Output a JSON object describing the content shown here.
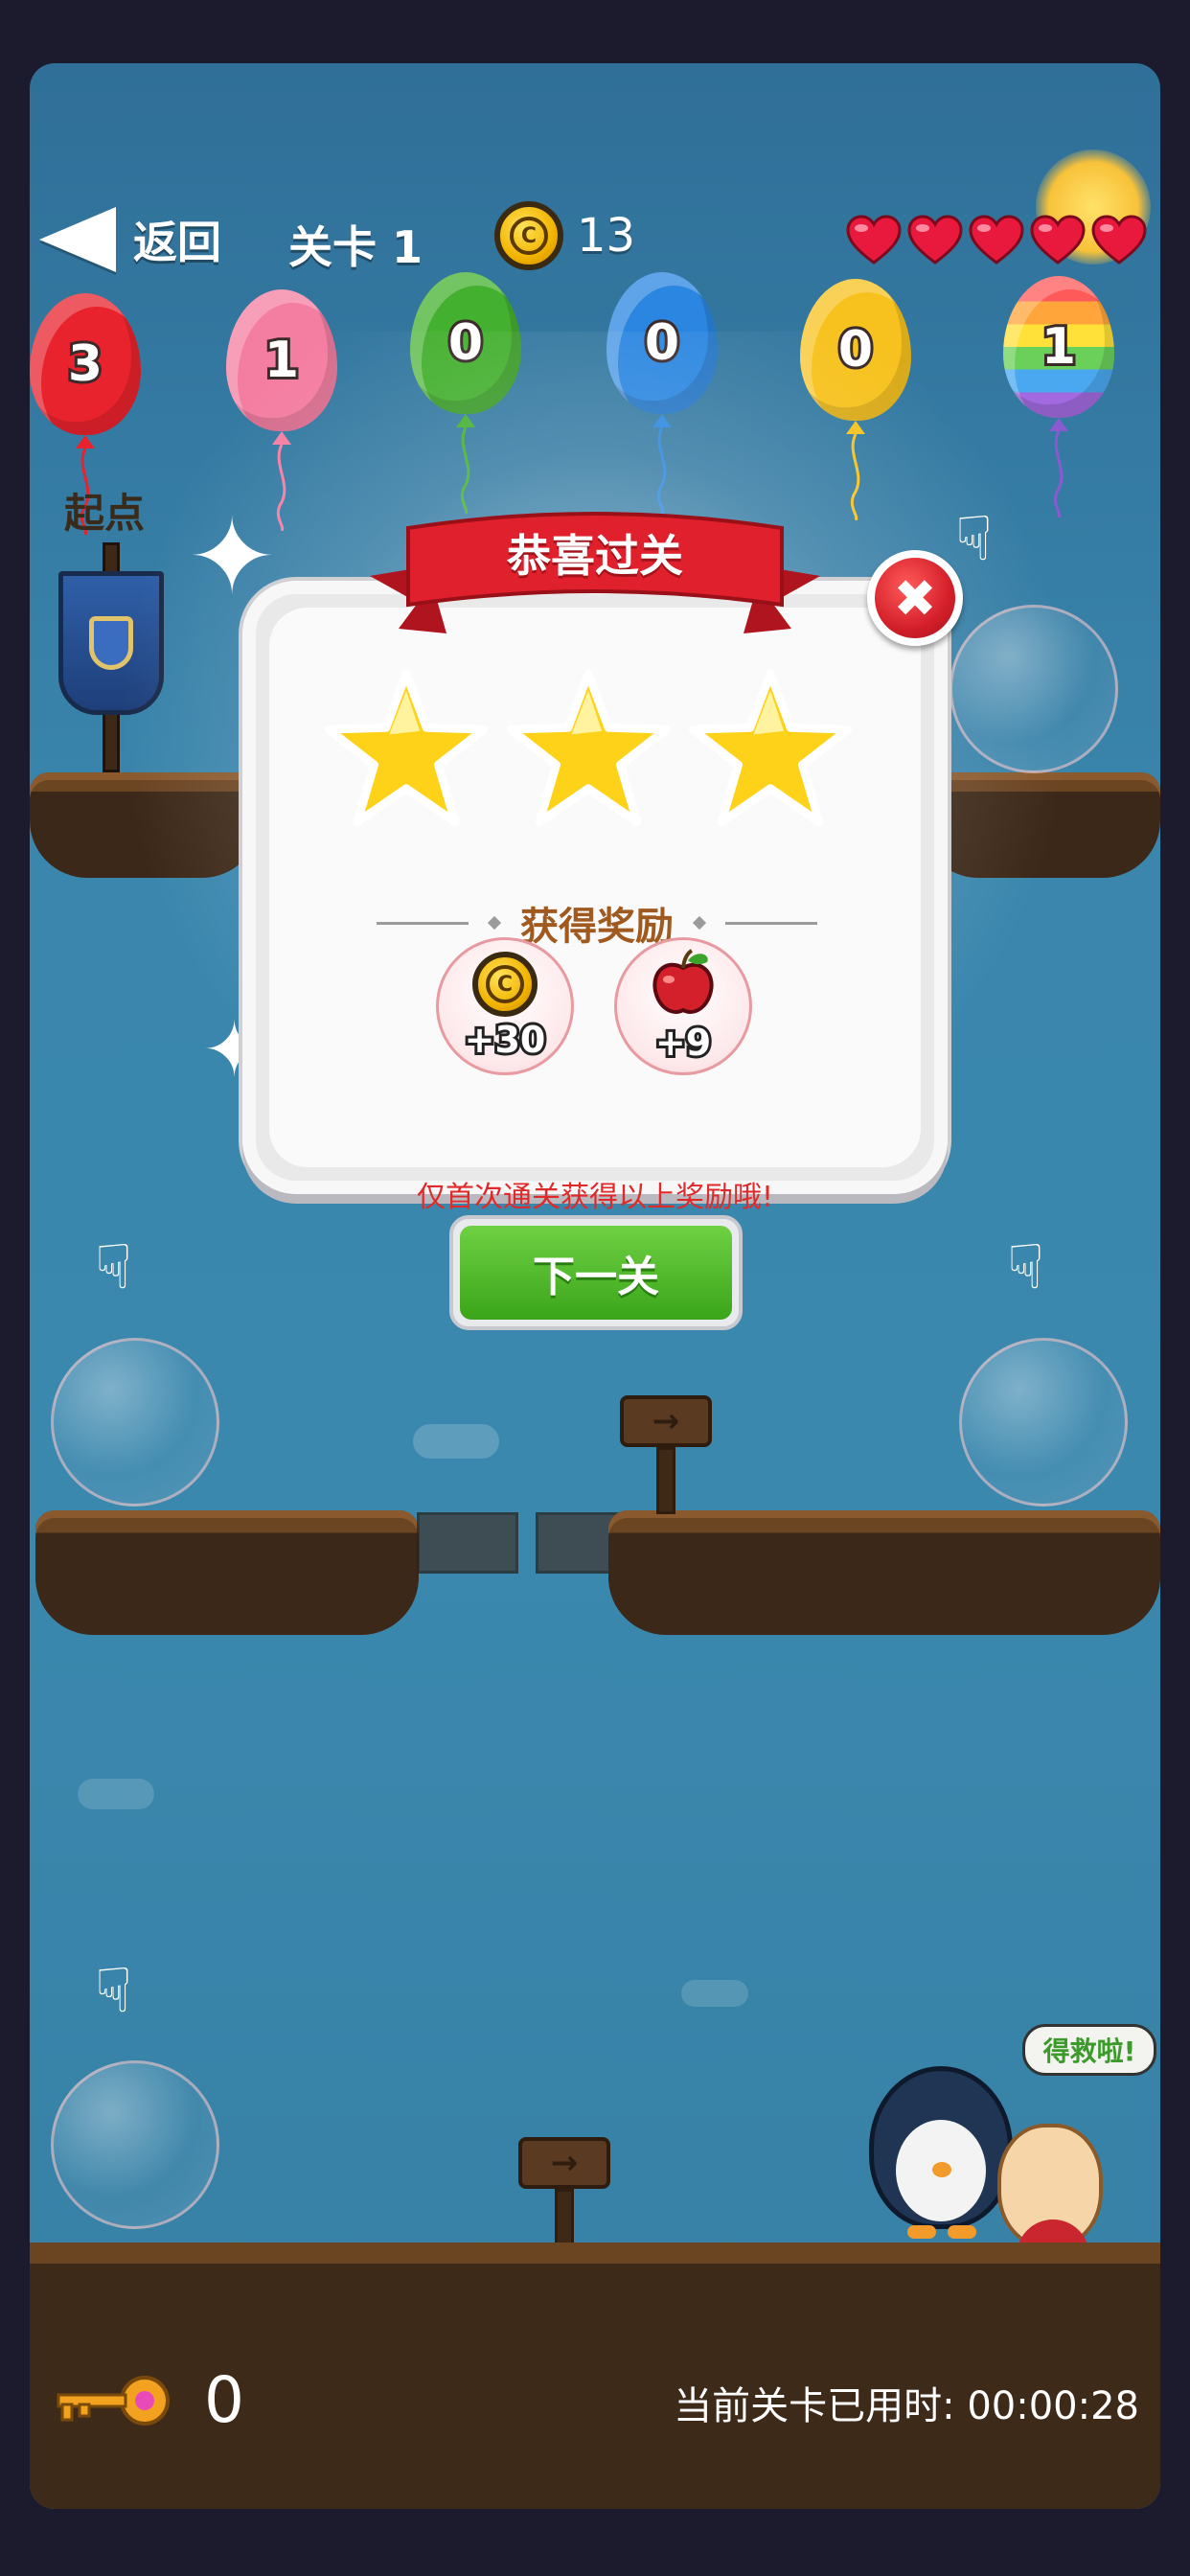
{
  "topbar": {
    "back_label": "返回",
    "level_label": "关卡 1",
    "coins": "13",
    "hearts": 5
  },
  "balloons": [
    {
      "num": "3",
      "color": "#e8232d"
    },
    {
      "num": "1",
      "color": "#f47ea2"
    },
    {
      "num": "0",
      "color": "#44b02f"
    },
    {
      "num": "0",
      "color": "#2a86e0"
    },
    {
      "num": "0",
      "color": "#f7c21e"
    },
    {
      "num": "1",
      "color": "rainbow"
    }
  ],
  "start_label": "起点",
  "modal": {
    "title": "恭喜过关",
    "stars": 3,
    "reward_heading": "获得奖励",
    "rewards": [
      {
        "icon": "coin-icon",
        "amount": "+30"
      },
      {
        "icon": "apple-icon",
        "amount": "+9"
      }
    ],
    "note": "仅首次通关获得以上奖励哦!",
    "next_label": "下一关"
  },
  "speech": "得救啦!",
  "footer": {
    "keys": "0",
    "timer": "当前关卡已用时:  00:00:28"
  },
  "colors": {
    "ribbon": "#e0202c",
    "button_green": "#3aa51a",
    "star": "#ffd21a"
  }
}
